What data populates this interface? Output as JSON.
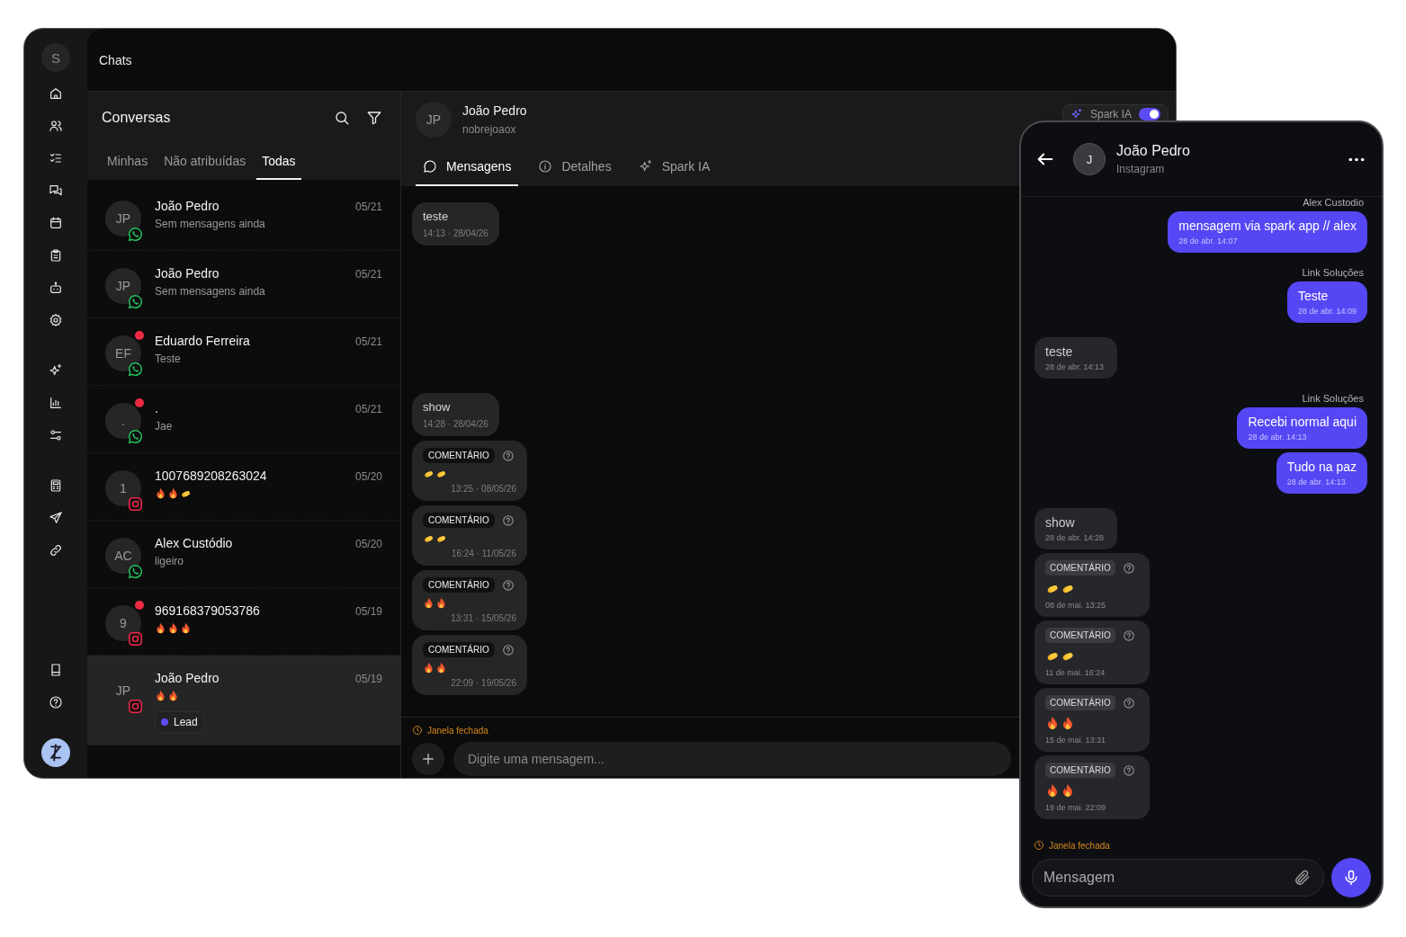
{
  "window": {
    "title": "Chats",
    "user_initial": "S"
  },
  "conversations": {
    "title": "Conversas",
    "tabs": [
      {
        "label": "Minhas",
        "selected": false
      },
      {
        "label": "Não atribuídas",
        "selected": false
      },
      {
        "label": "Todas",
        "selected": true
      }
    ],
    "items": [
      {
        "initials": "JP",
        "name": "João Pedro",
        "preview": "Sem mensagens ainda",
        "date": "05/21",
        "channel": {
          "kind": "whatsapp"
        },
        "unread": false,
        "selected": false
      },
      {
        "initials": "JP",
        "name": "João Pedro",
        "preview": "Sem mensagens ainda",
        "date": "05/21",
        "channel": {
          "kind": "whatsapp"
        },
        "unread": false,
        "selected": false
      },
      {
        "initials": "EF",
        "name": "Eduardo Ferreira",
        "preview": "Teste",
        "date": "05/21",
        "channel": {
          "kind": "whatsapp"
        },
        "unread": true,
        "selected": false
      },
      {
        "initials": ".",
        "name": ".",
        "preview": "Jae",
        "date": "05/21",
        "channel": {
          "kind": "whatsapp"
        },
        "unread": true,
        "selected": false
      },
      {
        "initials": "1",
        "name": "1007689208263024",
        "emojis": [
          {
            "kind": "fire"
          },
          {
            "kind": "fire"
          },
          {
            "kind": "clap"
          }
        ],
        "date": "05/20",
        "channel": {
          "kind": "instagram"
        },
        "unread": false,
        "selected": false
      },
      {
        "initials": "AC",
        "name": "Alex Custódio",
        "preview": "ligeiro",
        "date": "05/20",
        "channel": {
          "kind": "whatsapp"
        },
        "unread": false,
        "selected": false
      },
      {
        "initials": "9",
        "name": "969168379053786",
        "emojis": [
          {
            "kind": "fire"
          },
          {
            "kind": "fire"
          },
          {
            "kind": "fire"
          }
        ],
        "date": "05/19",
        "channel": {
          "kind": "instagram"
        },
        "unread": true,
        "selected": false
      },
      {
        "initials": "JP",
        "name": "João Pedro",
        "emojis": [
          {
            "kind": "fire"
          },
          {
            "kind": "fire"
          }
        ],
        "date": "05/19",
        "channel": {
          "kind": "instagram"
        },
        "unread": false,
        "selected": true,
        "tag": {
          "label": "Lead",
          "color": "#5b4cf5"
        }
      }
    ]
  },
  "chat": {
    "initials": "JP",
    "name": "João Pedro",
    "handle": "nobrejoaox",
    "spark_toggle": {
      "label": "Spark IA",
      "on": true
    },
    "tabs": [
      {
        "label": "Mensagens",
        "selected": true
      },
      {
        "label": "Detalhes",
        "selected": false
      },
      {
        "label": "Spark IA",
        "selected": false
      }
    ],
    "messages": [
      {
        "kind": "text",
        "text": "teste",
        "time": "14:13 · 28/04/26"
      },
      {
        "kind": "text",
        "text": "show",
        "time": "14:28 · 28/04/26"
      },
      {
        "kind": "comment",
        "label": "COMENTÁRIO",
        "emojis": [
          {
            "kind": "clap"
          },
          {
            "kind": "clap"
          }
        ],
        "time": "13:25 · 08/05/26"
      },
      {
        "kind": "comment",
        "label": "COMENTÁRIO",
        "emojis": [
          {
            "kind": "clap"
          },
          {
            "kind": "clap"
          }
        ],
        "time": "16:24 · 11/05/26"
      },
      {
        "kind": "comment",
        "label": "COMENTÁRIO",
        "emojis": [
          {
            "kind": "fire"
          },
          {
            "kind": "fire"
          }
        ],
        "time": "13:31 · 15/05/26"
      },
      {
        "kind": "comment",
        "label": "COMENTÁRIO",
        "emojis": [
          {
            "kind": "fire"
          },
          {
            "kind": "fire"
          }
        ],
        "time": "22:09 · 19/05/26"
      }
    ],
    "notice": "Janela fechada",
    "input_placeholder": "Digite uma mensagem..."
  },
  "phone": {
    "initial": "J",
    "name": "João Pedro",
    "subtitle": "Instagram",
    "messages": [
      {
        "kind": "text",
        "outgoing": true,
        "sender": "Alex Custodio",
        "text": "mensagem via spark app // alex",
        "time": "28 de abr. 14:07"
      },
      {
        "kind": "text",
        "outgoing": true,
        "sender": "Link Soluções",
        "text": "Teste",
        "time": "28 de abr. 14:09"
      },
      {
        "kind": "text",
        "outgoing": false,
        "text": "teste",
        "time": "28 de abr. 14:13"
      },
      {
        "kind": "text",
        "outgoing": true,
        "sender": "Link Soluções",
        "text": "Recebi normal aqui",
        "time": "28 de abr. 14:13"
      },
      {
        "kind": "text",
        "outgoing": true,
        "text": "Tudo na paz",
        "time": "28 de abr. 14:13"
      },
      {
        "kind": "text",
        "outgoing": false,
        "text": "show",
        "time": "28 de abr. 14:28"
      },
      {
        "kind": "comment",
        "outgoing": false,
        "label": "COMENTÁRIO",
        "emojis": [
          {
            "kind": "clap"
          },
          {
            "kind": "clap"
          }
        ],
        "time": "08 de mai. 13:25"
      },
      {
        "kind": "comment",
        "outgoing": false,
        "label": "COMENTÁRIO",
        "emojis": [
          {
            "kind": "clap"
          },
          {
            "kind": "clap"
          }
        ],
        "time": "11 de mai. 16:24"
      },
      {
        "kind": "comment",
        "outgoing": false,
        "label": "COMENTÁRIO",
        "emojis": [
          {
            "kind": "fire"
          },
          {
            "kind": "fire"
          }
        ],
        "time": "15 de mai. 13:31"
      },
      {
        "kind": "comment",
        "outgoing": false,
        "label": "COMENTÁRIO",
        "emojis": [
          {
            "kind": "fire"
          },
          {
            "kind": "fire"
          }
        ],
        "time": "19 de mai. 22:09"
      }
    ],
    "notice": "Janela fechada",
    "input_placeholder": "Mensagem"
  }
}
